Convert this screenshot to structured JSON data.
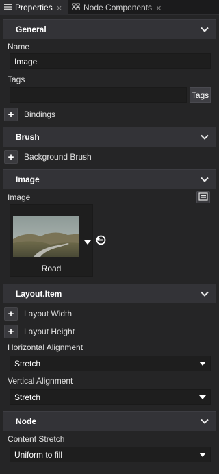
{
  "tabs": [
    {
      "label": "Properties",
      "icon": "list-icon",
      "active": true
    },
    {
      "label": "Node Components",
      "icon": "components-icon",
      "active": false
    }
  ],
  "sections": {
    "general": "General",
    "brush": "Brush",
    "image": "Image",
    "layout_item": "Layout.Item",
    "node": "Node"
  },
  "general": {
    "name_label": "Name",
    "name_value": "Image",
    "tags_label": "Tags",
    "tags_value": "",
    "tags_button": "Tags",
    "bindings_label": "Bindings"
  },
  "brush": {
    "background_label": "Background Brush"
  },
  "image": {
    "image_label": "Image",
    "image_name": "Road"
  },
  "layout": {
    "width_label": "Layout Width",
    "height_label": "Layout Height",
    "h_align_label": "Horizontal Alignment",
    "h_align_value": "Stretch",
    "v_align_label": "Vertical Alignment",
    "v_align_value": "Stretch"
  },
  "node": {
    "content_stretch_label": "Content Stretch",
    "content_stretch_value": "Uniform to fill"
  }
}
